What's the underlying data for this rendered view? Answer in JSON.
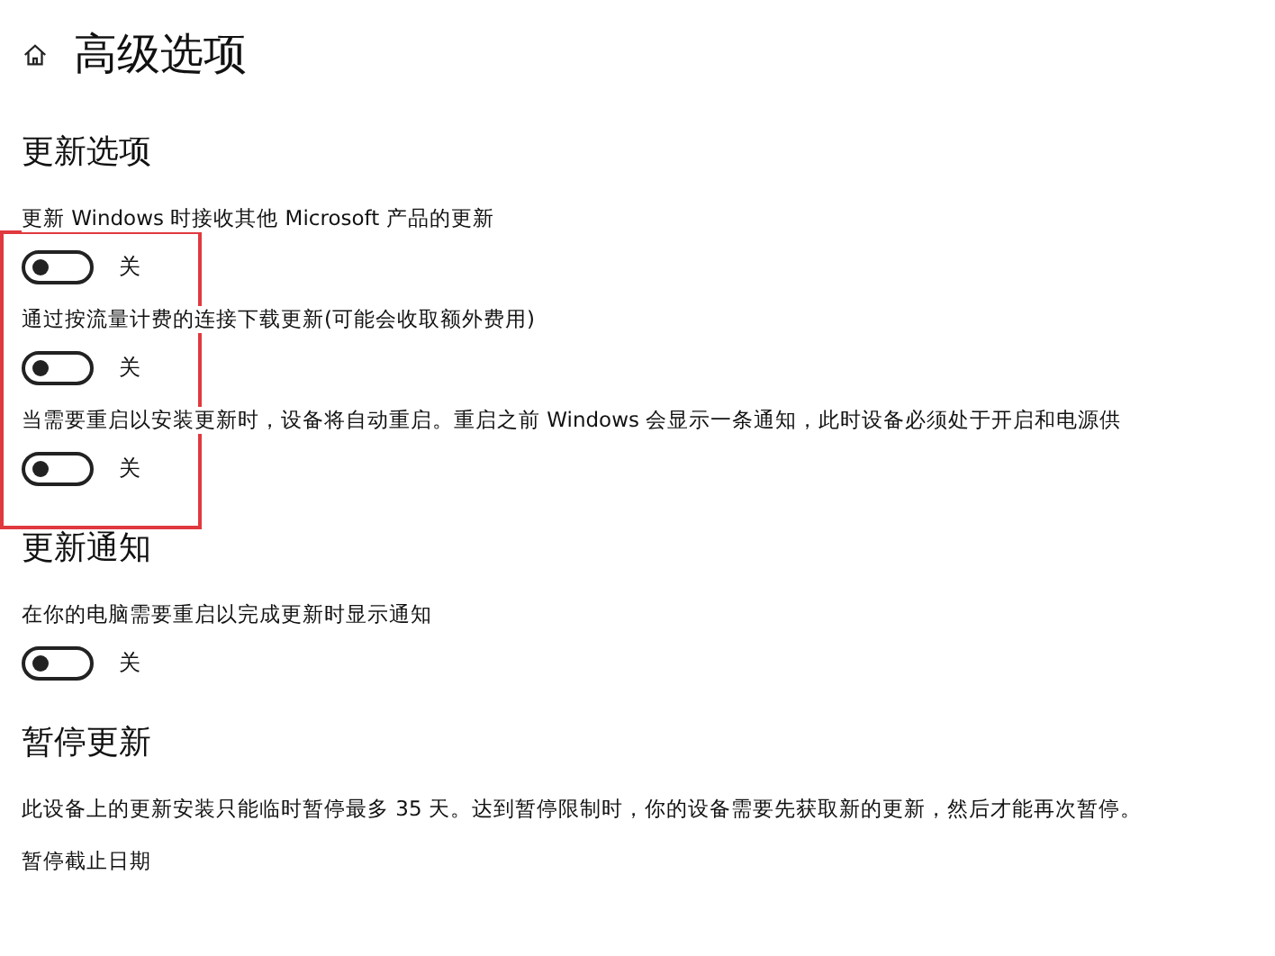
{
  "page": {
    "title": "高级选项"
  },
  "sections": [
    {
      "heading": "更新选项",
      "settings": [
        {
          "label": "更新 Windows 时接收其他 Microsoft 产品的更新",
          "on": false,
          "state": "关"
        },
        {
          "label": "通过按流量计费的连接下载更新(可能会收取额外费用)",
          "on": false,
          "state": "关"
        },
        {
          "label": "当需要重启以安装更新时，设备将自动重启。重启之前 Windows 会显示一条通知，此时设备必须处于开启和电源供",
          "on": false,
          "state": "关"
        }
      ]
    },
    {
      "heading": "更新通知",
      "settings": [
        {
          "label": "在你的电脑需要重启以完成更新时显示通知",
          "on": false,
          "state": "关"
        }
      ]
    },
    {
      "heading": "暂停更新",
      "paragraphs": [
        "此设备上的更新安装只能临时暂停最多 35 天。达到暂停限制时，你的设备需要先获取新的更新，然后才能再次暂停。",
        "暂停截止日期"
      ]
    }
  ]
}
